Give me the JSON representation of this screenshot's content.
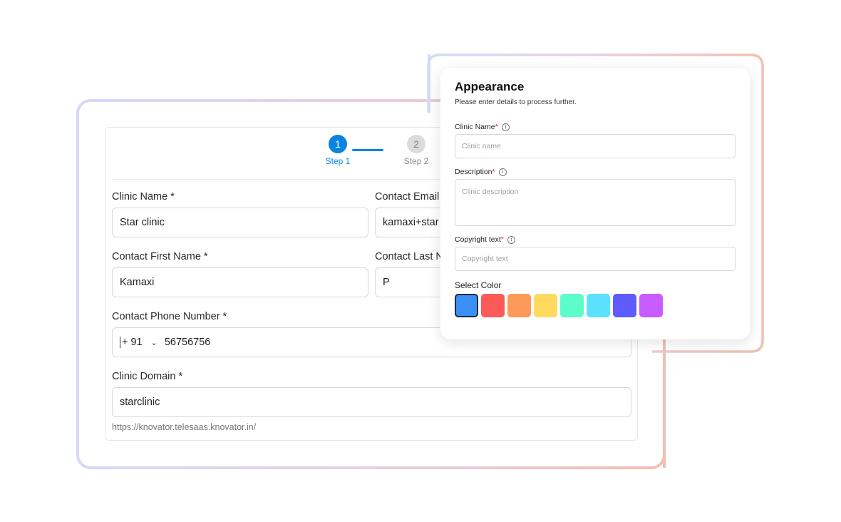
{
  "wizard": {
    "steps": [
      {
        "number": "1",
        "label": "Step 1",
        "state": "active"
      },
      {
        "number": "2",
        "label": "Step 2",
        "state": "inactive"
      }
    ],
    "fields": {
      "clinic_name": {
        "label": "Clinic Name *",
        "value": "Star clinic"
      },
      "contact_email": {
        "label": "Contact Email",
        "value": "kamaxi+star"
      },
      "first_name": {
        "label": "Contact First Name *",
        "value": "Kamaxi"
      },
      "last_name": {
        "label": "Contact Last N",
        "value": "P"
      },
      "phone": {
        "label": "Contact Phone Number *",
        "country_code": "+ 91",
        "value": "56756756"
      },
      "domain": {
        "label": "Clinic Domain *",
        "value": "starclinic",
        "hint": "https://knovator.telesaas.knovator.in/"
      }
    }
  },
  "appearance": {
    "title": "Appearance",
    "subtitle": "Please enter details to process further.",
    "clinic_name": {
      "label": "Clinic Name",
      "required": "*",
      "placeholder": "Clinic name"
    },
    "description": {
      "label": "Description",
      "required": "*",
      "placeholder": "Clinic description"
    },
    "copyright": {
      "label": "Copyright text",
      "required": "*",
      "placeholder": "Copyright text"
    },
    "select_color_label": "Select Color",
    "colors": [
      "#3a8ff5",
      "#fb5a58",
      "#fd9a5a",
      "#fedb5e",
      "#5dfdc9",
      "#5ce1fe",
      "#5e5cfe",
      "#c95cfe"
    ],
    "selected_color_index": 0,
    "info_icon_glyph": "i"
  },
  "accent_color": "#0a84e0"
}
